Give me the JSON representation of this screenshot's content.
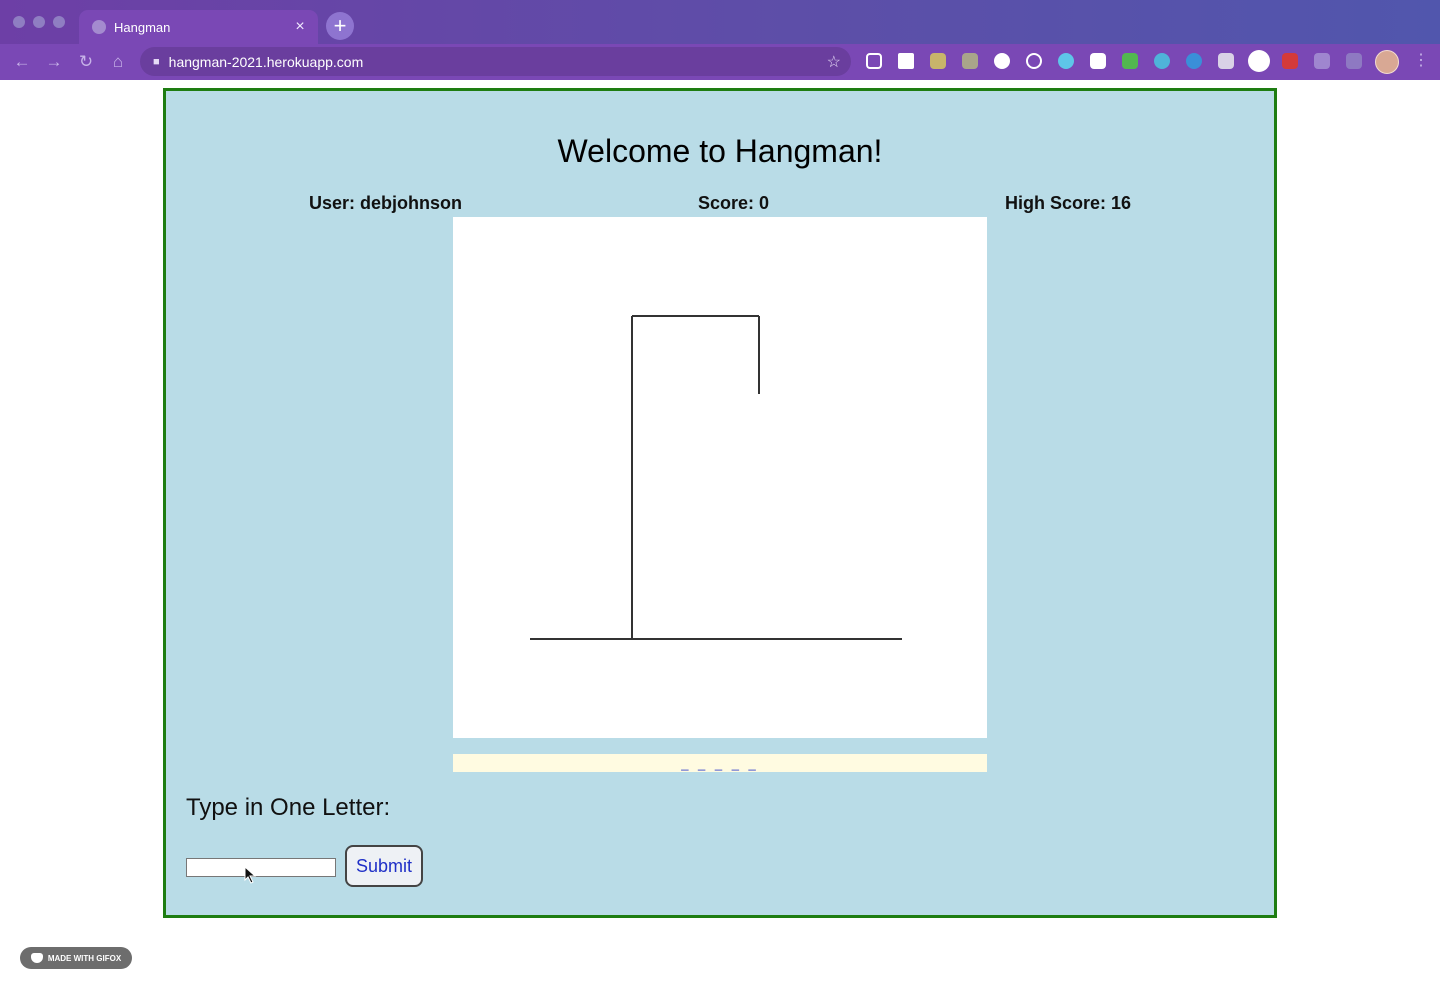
{
  "browser": {
    "tab_title": "Hangman",
    "tab_close": "×",
    "new_tab": "+",
    "url": "hangman-2021.herokuapp.com",
    "nav": {
      "back": "←",
      "forward": "→",
      "reload": "↻",
      "home": "⌂"
    },
    "menu": "⋮",
    "extensions": [
      "pocket-icon",
      "plus-icon",
      "puzzle-icon",
      "battery-icon",
      "circle-icon",
      "target-icon",
      "react-icon",
      "square-icon",
      "cors-icon",
      "m-icon",
      "compass-icon",
      "bookmark-icon",
      "pinterest-icon",
      "password-icon",
      "extensions-icon",
      "playlist-icon"
    ],
    "accent": "#6d3fa6"
  },
  "game": {
    "heading": "Welcome to Hangman!",
    "user_label": "User: debjohnson",
    "score_label": "Score: 0",
    "high_score_label": "High Score: 16",
    "word_display": "_ _ _ _ _",
    "prompt": "Type in One Letter:",
    "input_value": "",
    "submit_label": "Submit",
    "colors": {
      "background": "#b9dce7",
      "border": "#1e7d12",
      "word_bar": "#fffbe1",
      "button_text": "#1f2fc7"
    }
  },
  "watermark": {
    "text": "MADE WITH GIFOX"
  }
}
